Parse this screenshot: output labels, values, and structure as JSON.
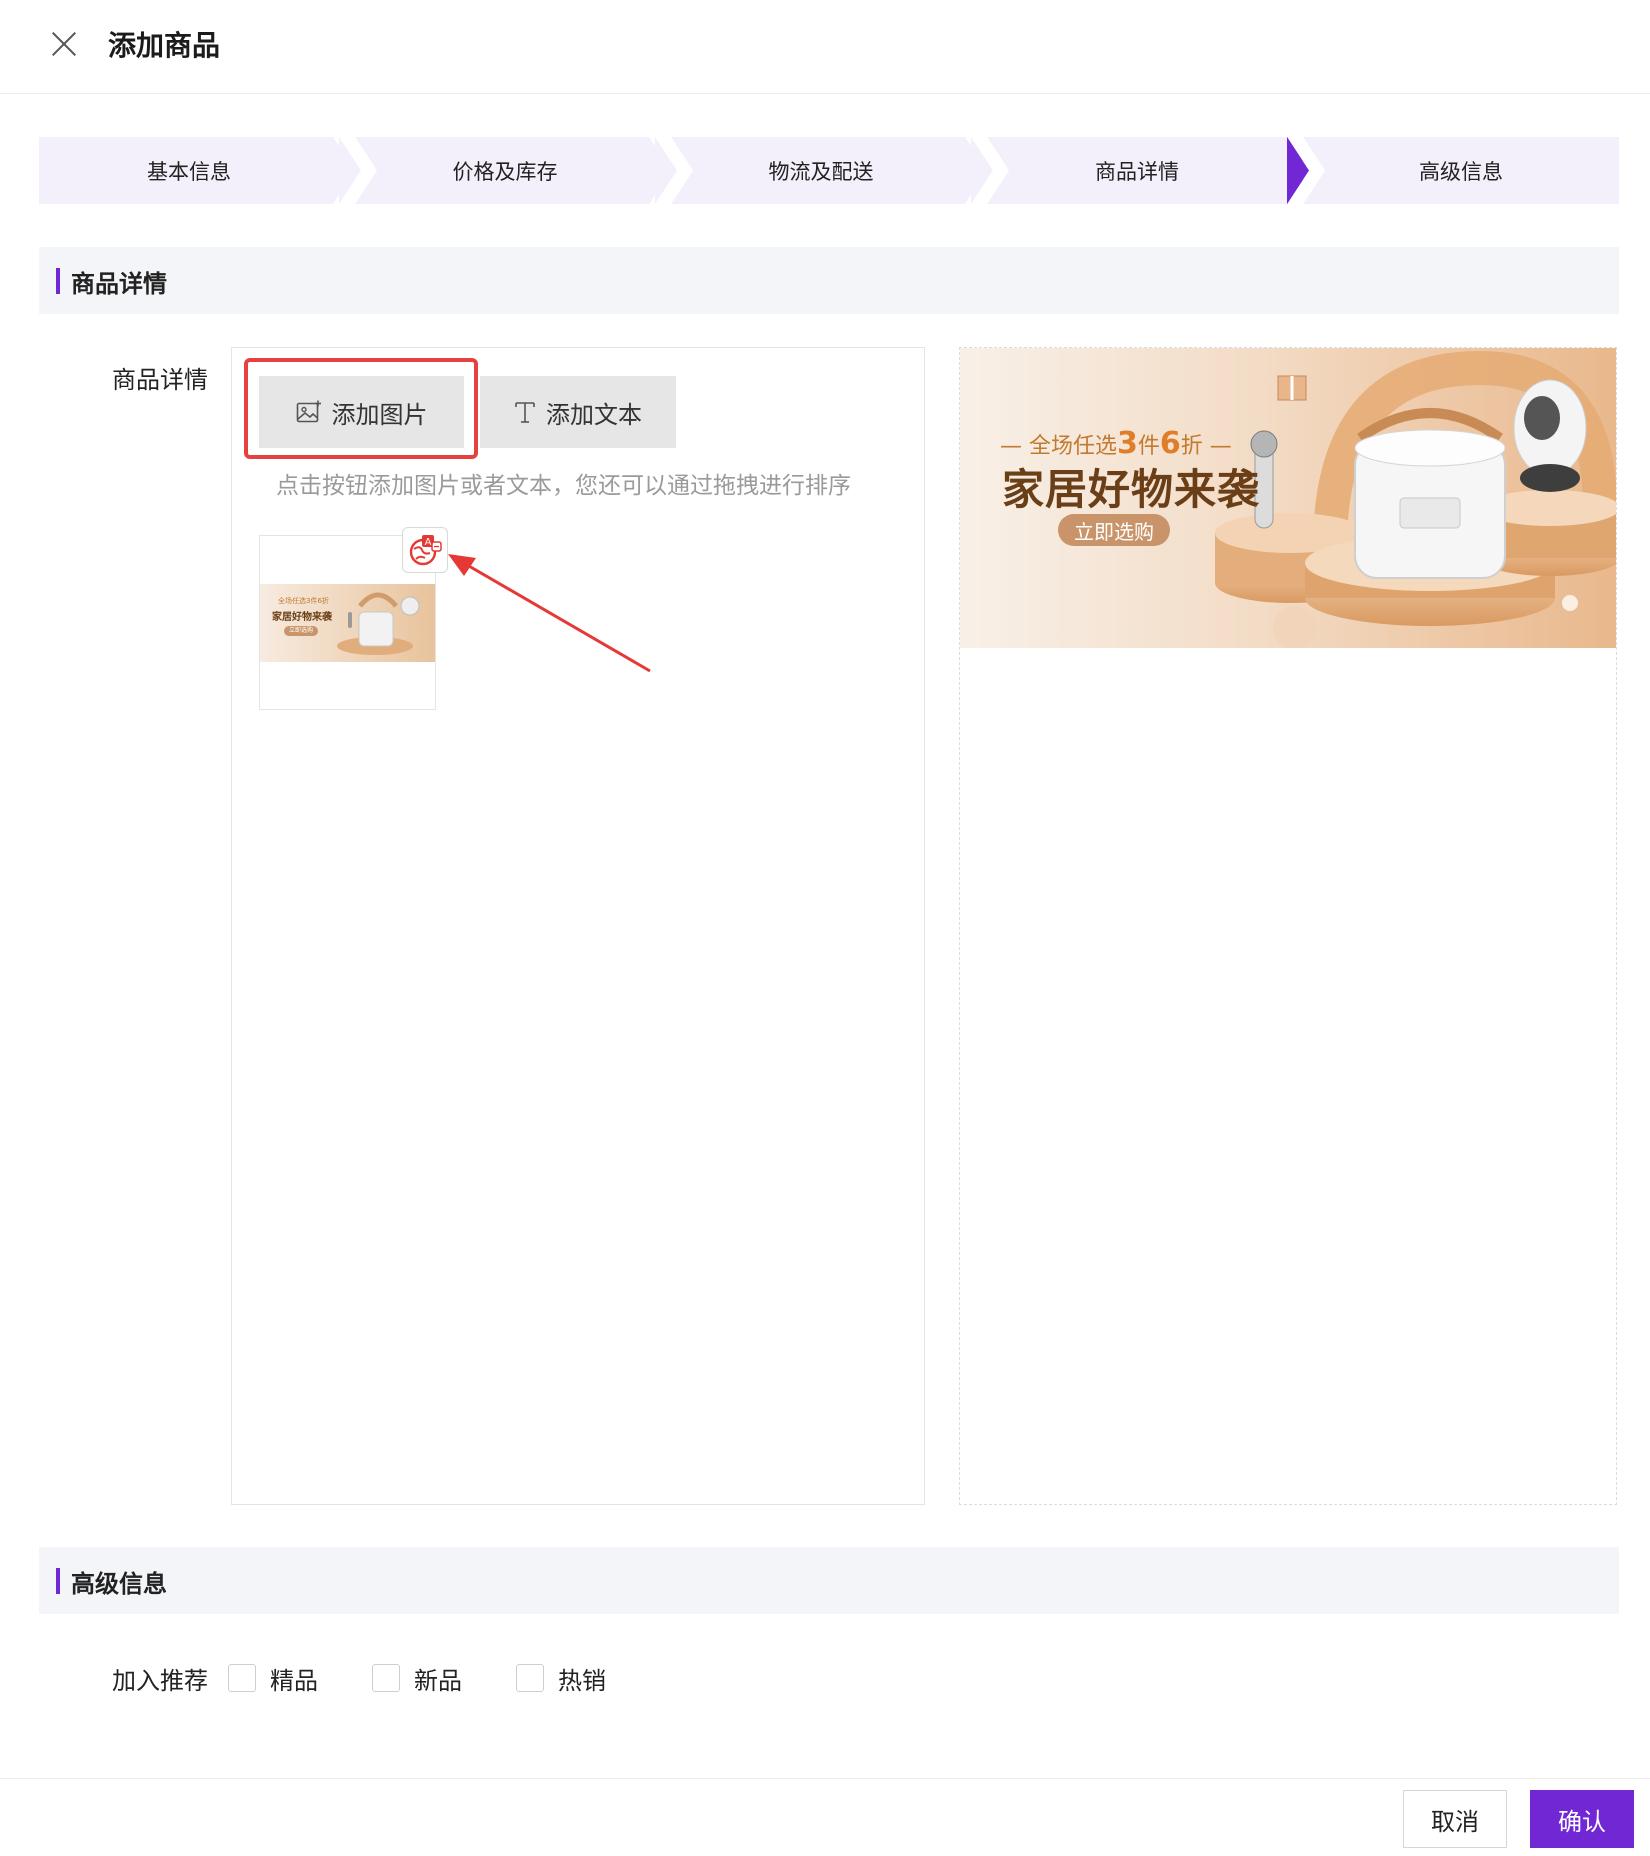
{
  "header": {
    "title": "添加商品",
    "close_icon": "close-icon"
  },
  "steps": [
    {
      "label": "基本信息",
      "active": false
    },
    {
      "label": "价格及库存",
      "active": false
    },
    {
      "label": "物流及配送",
      "active": false
    },
    {
      "label": "商品详情",
      "active": true
    },
    {
      "label": "高级信息",
      "active": false
    }
  ],
  "detail_section": {
    "title": "商品详情",
    "field_label": "商品详情",
    "add_image_label": "添加图片",
    "add_text_label": "添加文本",
    "hint": "点击按钮添加图片或者文本，您还可以通过拖拽进行排序"
  },
  "thumbnail_banner": {
    "tag": "全场任选3件6折",
    "title": "家居好物来袭",
    "button": "立即选购"
  },
  "preview_banner": {
    "tag_prefix": "— 全场任选",
    "tag_num1": "3",
    "tag_mid": "件",
    "tag_num2": "6",
    "tag_suffix": "折 —",
    "title": "家居好物来袭",
    "button": "立即选购"
  },
  "advanced_section": {
    "title": "高级信息",
    "field_label": "加入推荐",
    "options": [
      "精品",
      "新品",
      "热销"
    ]
  },
  "footer": {
    "cancel_label": "取消",
    "confirm_label": "确认"
  },
  "colors": {
    "accent": "#7128d4",
    "highlight": "#e74040",
    "step_bg": "#f4f0fb"
  }
}
